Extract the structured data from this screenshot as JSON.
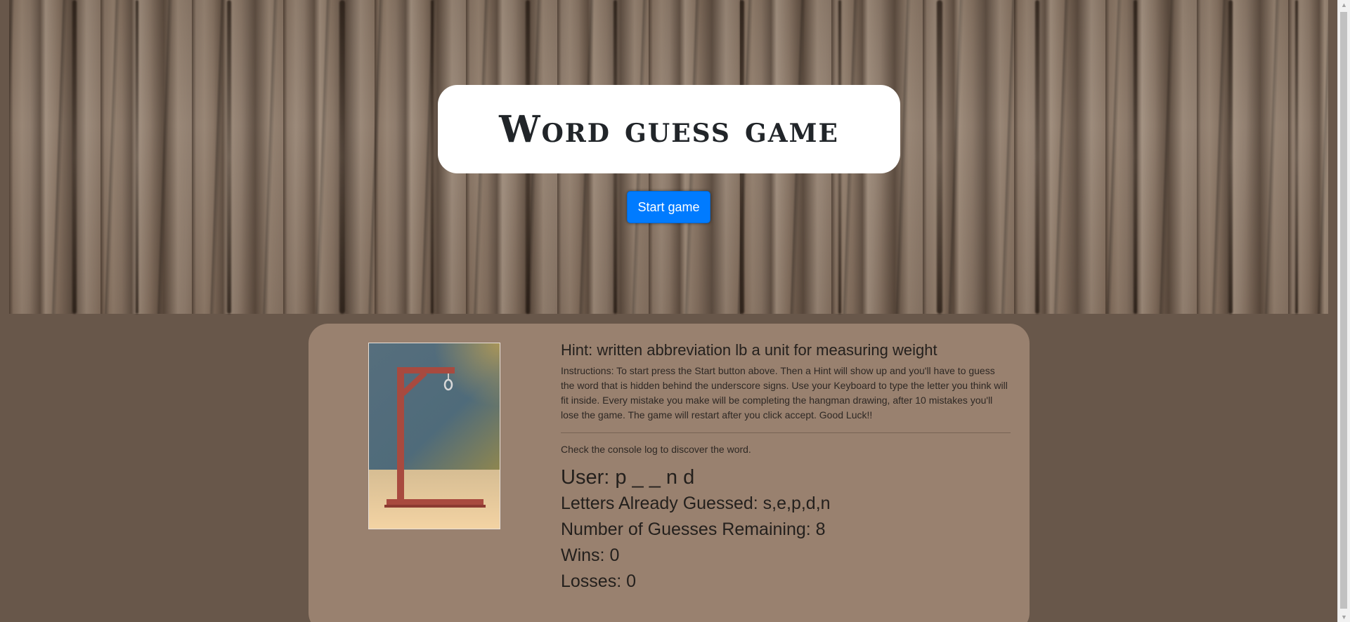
{
  "header": {
    "title": "Word guess game",
    "start_button": "Start game"
  },
  "game": {
    "hint": "Hint: written abbreviation lb a unit for measuring weight",
    "instructions": "Instructions: To start press the Start button above. Then a Hint will show up and you'll have to guess the word that is hidden behind the underscore signs. Use your Keyboard to type the letter you think will fit inside. Every mistake you make will be completing the hangman drawing, after 10 mistakes you'll lose the game. The game will restart after you click accept. Good Luck!!",
    "console_note": "Check the console log to discover the word.",
    "user": "User: p _ _ n d",
    "letters_guessed": "Letters Already Guessed: s,e,p,d,n",
    "guesses_remaining": "Number of Guesses Remaining: 8",
    "wins": "Wins: 0",
    "losses": "Losses: 0"
  },
  "icons": {
    "hangman_image": "gallows-icon",
    "scroll_up": "chevron-up-icon",
    "scroll_down": "chevron-down-icon"
  },
  "colors": {
    "button": "#007bff",
    "card": "#99816f",
    "page_background": "#68574a"
  }
}
